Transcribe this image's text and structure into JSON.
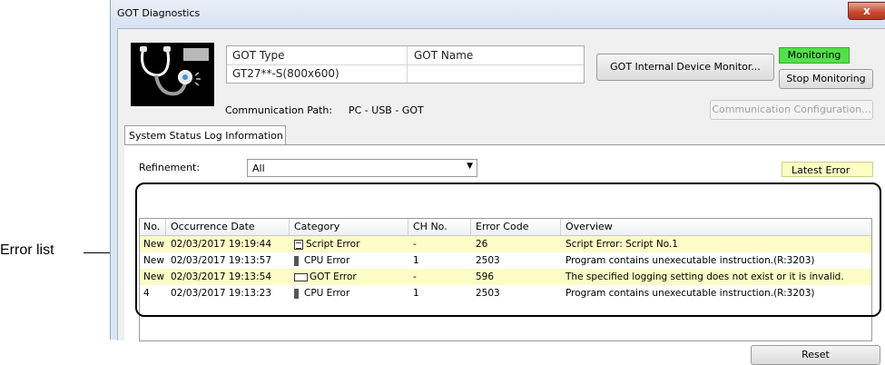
{
  "callout": {
    "label": "Error list"
  },
  "window": {
    "title": "GOT Diagnostics",
    "close_glyph": "x"
  },
  "got_info": {
    "type_header": "GOT Type",
    "name_header": "GOT Name",
    "type_value": "GT27**-S(800x600)",
    "name_value": ""
  },
  "buttons": {
    "internal_monitor": "GOT Internal Device Monitor...",
    "stop_monitoring": "Stop Monitoring",
    "comm_config": "Communication Configuration...",
    "reset": "Reset"
  },
  "status": {
    "monitoring": "Monitoring",
    "monitoring_color": "#52e04a"
  },
  "communication": {
    "label": "Communication Path:",
    "value": "PC - USB - GOT"
  },
  "tab": {
    "label": "System Status Log Information"
  },
  "refinement": {
    "label": "Refinement:",
    "value": "All"
  },
  "latest_error": {
    "label": "Latest Error",
    "color": "#fdfcc3"
  },
  "error_table": {
    "headers": [
      "No.",
      "Occurrence Date",
      "Category",
      "CH No.",
      "Error Code",
      "Overview"
    ],
    "rows": [
      {
        "no": "New",
        "date": "02/03/2017 19:19:44",
        "category": "Script Error",
        "icon": "script-icon",
        "ch": "-",
        "code": "26",
        "overview": "Script Error: Script No.1",
        "latest": true
      },
      {
        "no": "New",
        "date": "02/03/2017 19:13:57",
        "category": "CPU Error",
        "icon": "cpu-icon",
        "ch": "1",
        "code": "2503",
        "overview": "Program contains unexecutable instruction.(R:3203)",
        "latest": false
      },
      {
        "no": "New",
        "date": "02/03/2017 19:13:54",
        "category": "GOT Error",
        "icon": "got-icon",
        "ch": "-",
        "code": "596",
        "overview": "The specified logging setting does not exist or it is invalid.",
        "latest": true
      },
      {
        "no": "4",
        "date": "02/03/2017 19:13:23",
        "category": "CPU Error",
        "icon": "cpu-icon",
        "ch": "1",
        "code": "2503",
        "overview": "Program contains unexecutable instruction.(R:3203)",
        "latest": false
      }
    ]
  }
}
